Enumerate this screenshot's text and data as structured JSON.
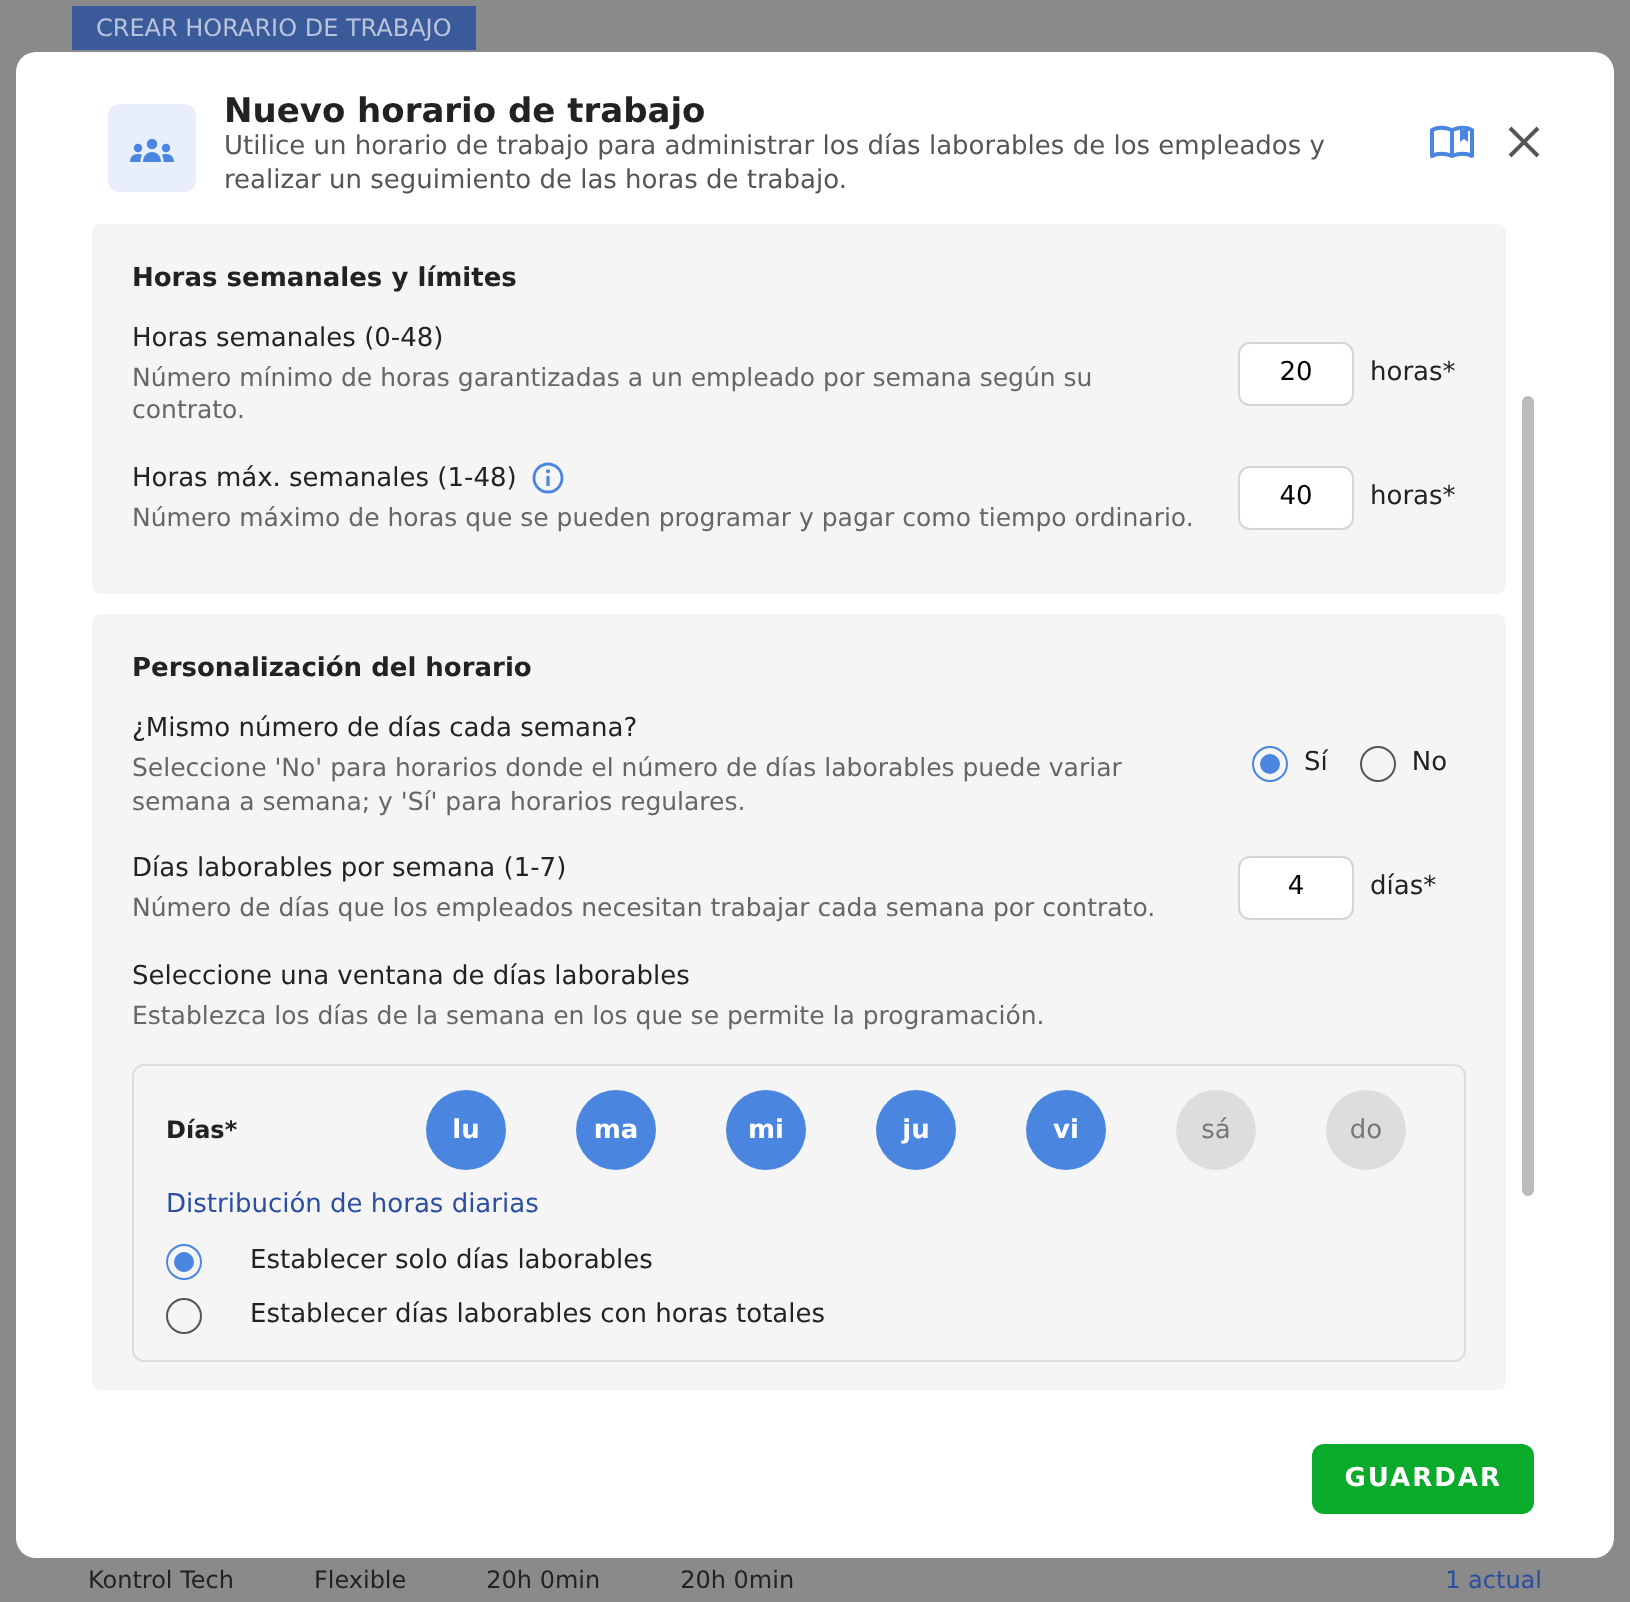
{
  "background": {
    "top_button": "CREAR HORARIO DE TRABAJO",
    "row": [
      "Kontrol Tech",
      "Flexible",
      "20h 0min",
      "20h 0min",
      "1 actual"
    ]
  },
  "dialog": {
    "title": "Nuevo horario de trabajo",
    "description": "Utilice un horario de trabajo para administrar los días laborables de los empleados y realizar un seguimiento de las horas de trabajo.",
    "sections": [
      {
        "title": "Horas semanales y límites",
        "fields": [
          {
            "kind": "number",
            "label": "Horas semanales (0-48)",
            "info": false,
            "description": "Número mínimo de horas garantizadas a un empleado por semana según su contrato.",
            "value": "20",
            "unit": "horas*"
          },
          {
            "kind": "number",
            "label": "Horas máx. semanales (1-48)",
            "info": true,
            "description": "Número máximo de horas que se pueden programar y pagar como tiempo ordinario.",
            "value": "40",
            "unit": "horas*"
          }
        ]
      },
      {
        "title": "Personalización del horario",
        "fields": [
          {
            "kind": "radio",
            "label": "¿Mismo número de días cada semana?",
            "description": "Seleccione 'No' para horarios donde el número de días laborables puede variar semana a semana; y 'Sí' para horarios regulares.",
            "options": [
              {
                "label": "Sí",
                "selected": true
              },
              {
                "label": "No",
                "selected": false
              }
            ]
          },
          {
            "kind": "number",
            "label": "Días laborables por semana (1-7)",
            "info": false,
            "description": "Número de días que los empleados necesitan trabajar cada semana por contrato.",
            "value": "4",
            "unit": "días*"
          },
          {
            "kind": "text",
            "label": "Seleccione una ventana de días laborables",
            "description": "Establezca los días de la semana en los que se permite la programación."
          },
          {
            "kind": "days",
            "label": "Días*",
            "days": [
              {
                "label": "lu",
                "selected": true
              },
              {
                "label": "ma",
                "selected": true
              },
              {
                "label": "mi",
                "selected": true
              },
              {
                "label": "ju",
                "selected": true
              },
              {
                "label": "vi",
                "selected": true
              },
              {
                "label": "sá",
                "selected": false
              },
              {
                "label": "do",
                "selected": false
              }
            ],
            "distribution_title": "Distribución de horas diarias",
            "options": [
              {
                "label": "Establecer solo días laborables",
                "selected": true
              },
              {
                "label": "Establecer días laborables con horas totales",
                "selected": false
              }
            ]
          }
        ]
      }
    ],
    "save_button": "GUARDAR"
  }
}
